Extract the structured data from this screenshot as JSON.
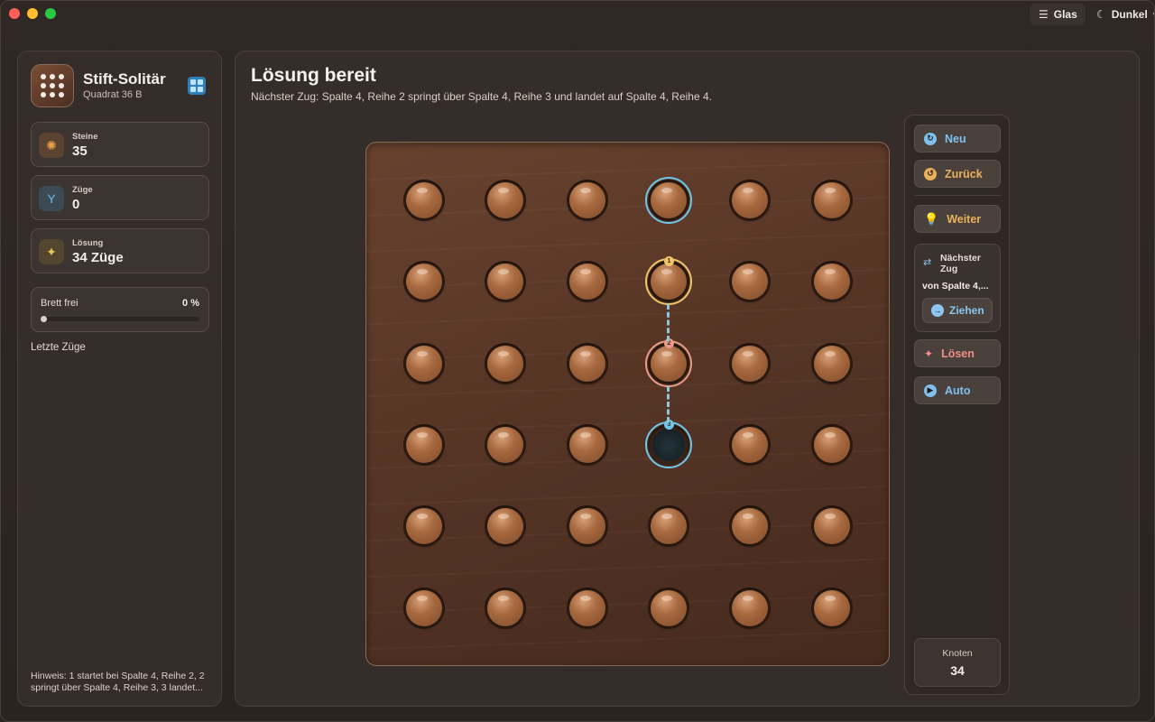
{
  "titlebar": {
    "glass_label": "Glas",
    "theme_label": "Dunkel",
    "icons": [
      "sliders-icon",
      "moon-icon",
      "chevron-down-icon"
    ]
  },
  "sidebar": {
    "app_title": "Stift-Solitär",
    "app_subtitle": "Quadrat 36 B",
    "stats": [
      {
        "label": "Steine",
        "value": "35",
        "icon": "pegs-icon",
        "color": "#e6a24a"
      },
      {
        "label": "Züge",
        "value": "0",
        "icon": "fork-icon",
        "color": "#6fb7e6"
      },
      {
        "label": "Lösung",
        "value": "34 Züge",
        "icon": "sparkle-icon",
        "color": "#e8c45a"
      }
    ],
    "progress": {
      "label": "Brett frei",
      "percent_text": "0 %",
      "value": 0
    },
    "recent_label": "Letzte Züge",
    "hint": "Hinweis: 1 startet bei Spalte 4, Reihe 2, 2 springt über Spalte 4, Reihe 3, 3 landet..."
  },
  "main": {
    "title": "Lösung bereit",
    "subtitle": "Nächster Zug: Spalte 4, Reihe 2 springt über Spalte 4, Reihe 3 und landet auf Spalte 4, Reihe 4."
  },
  "board": {
    "rows": 6,
    "cols": 6,
    "empty": [
      [
        3,
        3
      ]
    ],
    "highlights": [
      {
        "row": 0,
        "col": 3,
        "ring": "#6fc6e8",
        "badge": ""
      },
      {
        "row": 1,
        "col": 3,
        "ring": "#f0c56a",
        "badge": "1",
        "badge_color": "#f0c56a"
      },
      {
        "row": 2,
        "col": 3,
        "ring": "#e79a8a",
        "badge": "2",
        "badge_color": "#e79a8a"
      },
      {
        "row": 3,
        "col": 3,
        "ring": "#6fc6e8",
        "badge": "3",
        "badge_color": "#6fc6e8"
      }
    ]
  },
  "controls": {
    "new_label": "Neu",
    "back_label": "Zurück",
    "next_label": "Weiter",
    "next_move_title": "Nächster Zug",
    "next_move_detail": "von Spalte 4,...",
    "drag_label": "Ziehen",
    "solve_label": "Lösen",
    "auto_label": "Auto",
    "nodes_label": "Knoten",
    "nodes_value": "34",
    "colors": {
      "new": "#7fc0ee",
      "back": "#eab05c",
      "next": "#eab05c",
      "solve": "#ef8f86",
      "auto": "#7fc0ee"
    }
  }
}
